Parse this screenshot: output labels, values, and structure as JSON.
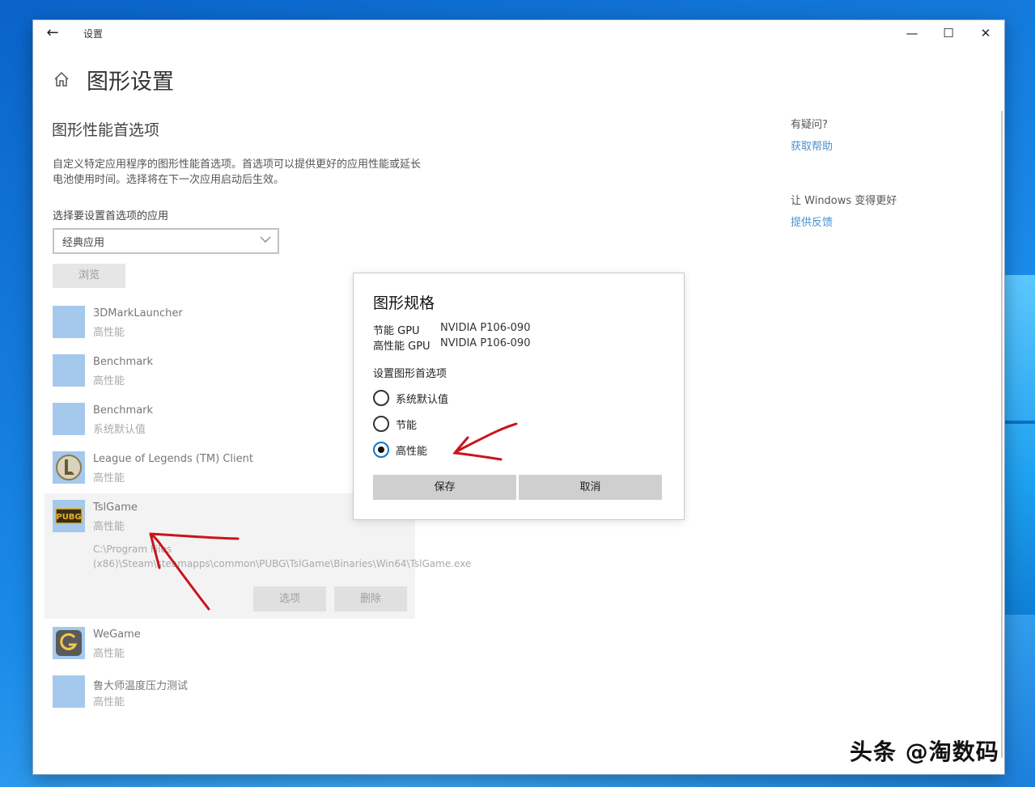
{
  "window": {
    "title": "设置",
    "back_glyph": "←",
    "min_glyph": "—",
    "max_glyph": "☐",
    "close_glyph": "✕"
  },
  "page": {
    "title": "图形设置",
    "section_title": "图形性能首选项",
    "description": "自定义特定应用程序的图形性能首选项。首选项可以提供更好的应用性能或延长电池使用时间。选择将在下一次应用启动后生效。",
    "select_label": "选择要设置首选项的应用",
    "dropdown_value": "经典应用",
    "browse_label": "浏览"
  },
  "apps": [
    {
      "name": "3DMarkLauncher",
      "mode": "高性能",
      "icon": "blank-app-icon"
    },
    {
      "name": "Benchmark",
      "mode": "高性能",
      "icon": "blank-app-icon"
    },
    {
      "name": "Benchmark",
      "mode": "系统默认值",
      "icon": "blank-app-icon"
    },
    {
      "name": "League of Legends (TM) Client",
      "mode": "高性能",
      "icon": "league-logo-icon"
    },
    {
      "name": "TslGame",
      "mode": "高性能",
      "icon": "pubg-logo-icon",
      "path": "C:\\Program Files (x86)\\Steam\\steamapps\\common\\PUBG\\TslGame\\Binaries\\Win64\\TslGame.exe",
      "pubg_text": "PUBG"
    },
    {
      "name": "WeGame",
      "mode": "高性能",
      "icon": "wegame-logo-icon"
    },
    {
      "name": "鲁大师温度压力测试",
      "mode": "高性能",
      "icon": "blank-app-icon"
    }
  ],
  "app_actions": {
    "options_label": "选项",
    "delete_label": "删除"
  },
  "sidebar": {
    "question": "有疑问?",
    "help_link": "获取帮助",
    "improve": "让 Windows 变得更好",
    "feedback_link": "提供反馈"
  },
  "dialog": {
    "title": "图形规格",
    "power_saving_gpu_label": "节能 GPU",
    "power_saving_gpu_value": "NVIDIA P106-090",
    "high_perf_gpu_label": "高性能 GPU",
    "high_perf_gpu_value": "NVIDIA P106-090",
    "pref_label": "设置图形首选项",
    "options": [
      {
        "label": "系统默认值",
        "checked": false
      },
      {
        "label": "节能",
        "checked": false
      },
      {
        "label": "高性能",
        "checked": true
      }
    ],
    "save_label": "保存",
    "cancel_label": "取消"
  },
  "watermark": "头条 @淘数码",
  "colors": {
    "accent": "#1a73c9",
    "link": "#4a90d0",
    "app_tile": "#a4c9ec",
    "annotation": "#c8151b"
  }
}
